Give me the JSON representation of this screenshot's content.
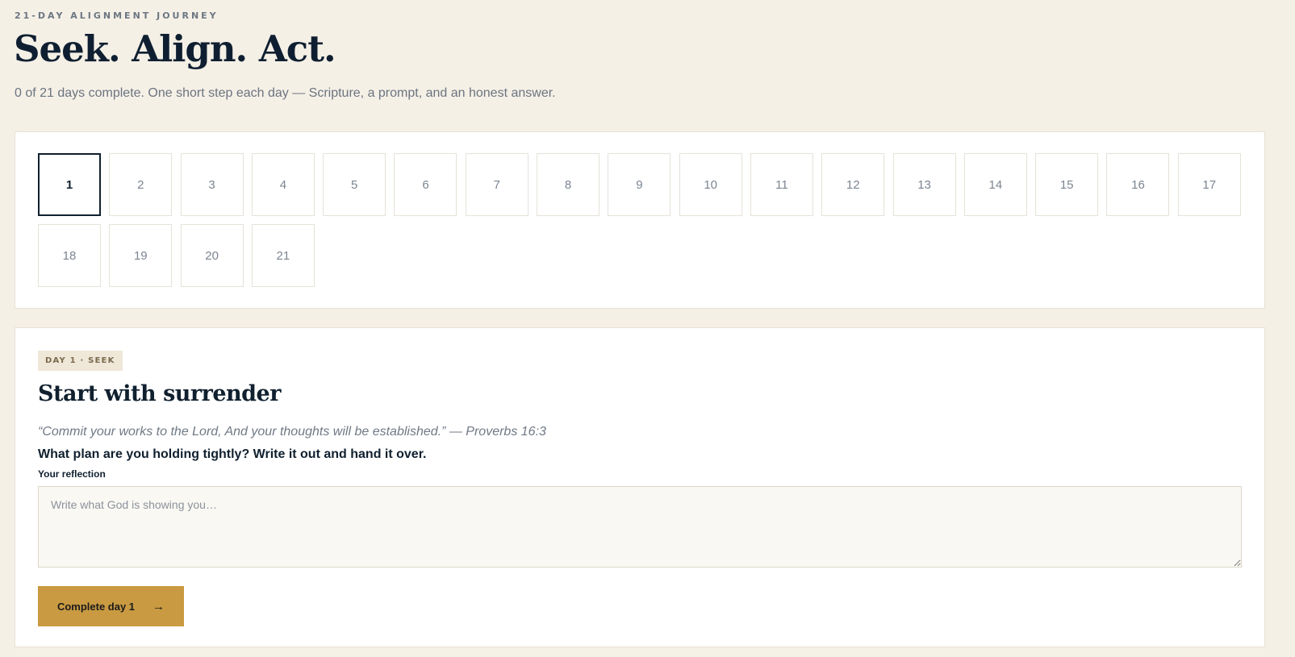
{
  "header": {
    "eyebrow": "21-DAY ALIGNMENT JOURNEY",
    "title": "Seek. Align. Act.",
    "subtitle": "0 of 21 days complete. One short step each day — Scripture, a prompt, and an honest answer."
  },
  "days": {
    "selected": 1,
    "items": [
      "1",
      "2",
      "3",
      "4",
      "5",
      "6",
      "7",
      "8",
      "9",
      "10",
      "11",
      "12",
      "13",
      "14",
      "15",
      "16",
      "17",
      "18",
      "19",
      "20",
      "21"
    ]
  },
  "day_card": {
    "tag": "DAY 1 · SEEK",
    "title": "Start with surrender",
    "scripture": "“Commit your works to the Lord, And your thoughts will be established.” — Proverbs 16:3",
    "prompt": "What plan are you holding tightly? Write it out and hand it over.",
    "reflection_label": "Your reflection",
    "reflection_placeholder": "Write what God is showing you…",
    "reflection_value": "",
    "button_label": "Complete day 1",
    "button_icon": "arrow-right-icon"
  },
  "colors": {
    "background": "#f5f0e6",
    "accent": "#c99a41",
    "ink": "#10202f",
    "muted": "#6b7480"
  }
}
